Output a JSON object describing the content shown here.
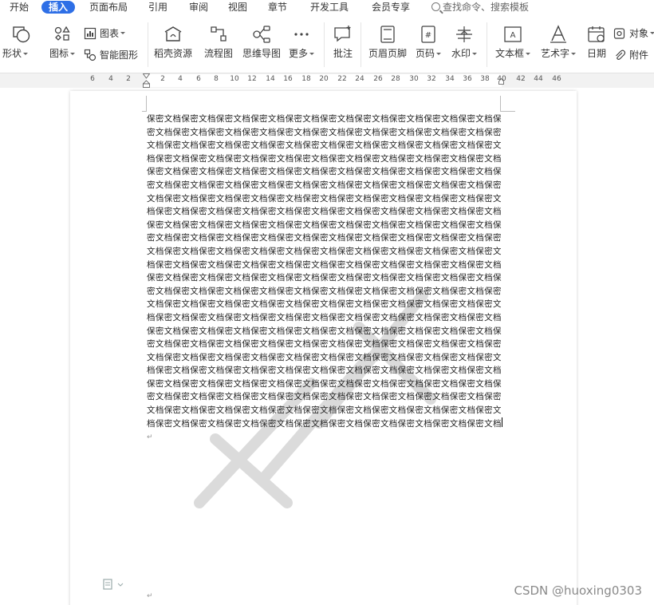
{
  "menu": {
    "items": [
      "开始",
      "插入",
      "页面布局",
      "引用",
      "审阅",
      "视图",
      "章节",
      "开发工具",
      "会员专享"
    ],
    "active_index": 1,
    "search_placeholder": "查找命令、搜索模板"
  },
  "toolbar": {
    "shape": "形状",
    "icon": "图标",
    "chart": "图表",
    "smart_graphic": "智能图形",
    "docer": "稻壳资源",
    "flowchart": "流程图",
    "mindmap": "思维导图",
    "more": "更多",
    "comment": "批注",
    "header_footer": "页眉页脚",
    "page_number": "页码",
    "watermark": "水印",
    "textbox": "文本框",
    "wordart": "艺术字",
    "date": "日期",
    "object": "对象",
    "attachment": "附件"
  },
  "ruler": {
    "labels": [
      "6",
      "4",
      "2",
      "2",
      "4",
      "6",
      "8",
      "10",
      "12",
      "14",
      "16",
      "18",
      "20",
      "22",
      "24",
      "26",
      "28",
      "30",
      "32",
      "34",
      "36",
      "38",
      "40",
      "42",
      "44",
      "46"
    ]
  },
  "document": {
    "repeated_phrase": "保密文档",
    "repeat_count": 246,
    "paragraph_mark": "↵"
  },
  "footer": {
    "credit": "CSDN @huoxing0303"
  },
  "colors": {
    "accent": "#2e6fe6",
    "watermark": "#c9c9c9"
  }
}
